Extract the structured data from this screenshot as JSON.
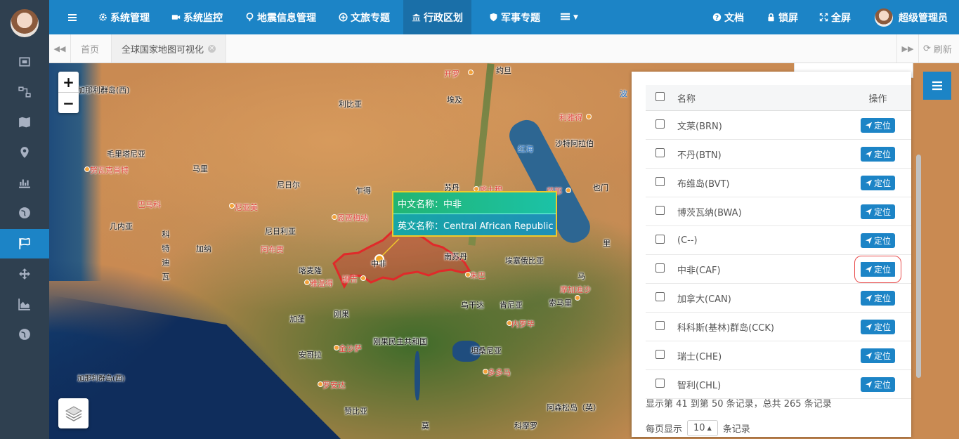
{
  "sidebar": {
    "items": [
      {
        "icon": "frame-icon"
      },
      {
        "icon": "network-icon"
      },
      {
        "icon": "map-icon"
      },
      {
        "icon": "map-marker-icon"
      },
      {
        "icon": "bar-chart-icon"
      },
      {
        "icon": "globe-icon"
      },
      {
        "icon": "flag-icon",
        "active": true
      },
      {
        "icon": "arrows-icon"
      },
      {
        "icon": "area-chart-icon"
      },
      {
        "icon": "globe-icon"
      }
    ]
  },
  "topbar": {
    "menu_icon": "hamburger-icon",
    "nav": [
      {
        "label": "系统管理",
        "icon": "gear-icon"
      },
      {
        "label": "系统监控",
        "icon": "video-icon"
      },
      {
        "label": "地震信息管理",
        "icon": "map-pin-icon"
      },
      {
        "label": "文旅专题",
        "icon": "plus-circle-icon"
      },
      {
        "label": "行政区划",
        "icon": "bank-icon",
        "active": true
      },
      {
        "label": "军事专题",
        "icon": "shield-icon"
      }
    ],
    "right": [
      {
        "label": "文档",
        "icon": "question-icon"
      },
      {
        "label": "锁屏",
        "icon": "lock-icon"
      },
      {
        "label": "全屏",
        "icon": "expand-icon"
      },
      {
        "label": "超级管理员",
        "icon": "avatar"
      }
    ]
  },
  "tabs": {
    "home": "首页",
    "active": "全球国家地图可视化",
    "refresh": "刷新"
  },
  "map": {
    "labels": [
      {
        "text": "利比亚",
        "type": "country"
      },
      {
        "text": "埃及",
        "type": "country"
      },
      {
        "text": "约旦",
        "type": "country"
      },
      {
        "text": "开罗",
        "type": "city"
      },
      {
        "text": "红海",
        "type": "blue"
      },
      {
        "text": "沙特阿拉伯",
        "type": "country"
      },
      {
        "text": "利雅得",
        "type": "city"
      },
      {
        "text": "毛里塔尼亚",
        "type": "country"
      },
      {
        "text": "努瓦克肖特",
        "type": "city"
      },
      {
        "text": "马里",
        "type": "country"
      },
      {
        "text": "尼日尔",
        "type": "country"
      },
      {
        "text": "乍得",
        "type": "country"
      },
      {
        "text": "苏丹",
        "type": "country"
      },
      {
        "text": "喀土穆",
        "type": "city"
      },
      {
        "text": "萨那",
        "type": "city"
      },
      {
        "text": "也门",
        "type": "country"
      },
      {
        "text": "巴马科",
        "type": "city"
      },
      {
        "text": "尼亚美",
        "type": "city"
      },
      {
        "text": "恩贾梅纳",
        "type": "city"
      },
      {
        "text": "几内亚",
        "type": "country"
      },
      {
        "text": "科特迪瓦",
        "type": "country-vertical"
      },
      {
        "text": "加纳",
        "type": "country"
      },
      {
        "text": "尼日利亚",
        "type": "country"
      },
      {
        "text": "阿布贾",
        "type": "city"
      },
      {
        "text": "喀麦隆",
        "type": "country"
      },
      {
        "text": "雅温得",
        "type": "city"
      },
      {
        "text": "班吉",
        "type": "city"
      },
      {
        "text": "中非",
        "type": "country"
      },
      {
        "text": "南苏丹",
        "type": "country"
      },
      {
        "text": "朱巴",
        "type": "city"
      },
      {
        "text": "埃塞俄比亚",
        "type": "country"
      },
      {
        "text": "索马里",
        "type": "country"
      },
      {
        "text": "摩加迪沙",
        "type": "city"
      },
      {
        "text": "加蓬",
        "type": "country"
      },
      {
        "text": "刚果",
        "type": "country"
      },
      {
        "text": "乌干达",
        "type": "country"
      },
      {
        "text": "肯尼亚",
        "type": "country"
      },
      {
        "text": "内罗毕",
        "type": "city"
      },
      {
        "text": "刚果民主共和国",
        "type": "country"
      },
      {
        "text": "金沙萨",
        "type": "city"
      },
      {
        "text": "安哥拉",
        "type": "country"
      },
      {
        "text": "罗安达",
        "type": "city"
      },
      {
        "text": "坦桑尼亚",
        "type": "country"
      },
      {
        "text": "多多马",
        "type": "city"
      },
      {
        "text": "赞比亚",
        "type": "country"
      },
      {
        "text": "莫",
        "type": "country"
      },
      {
        "text": "科摩罗",
        "type": "country"
      },
      {
        "text": "阿森松岛（英）",
        "type": "country"
      },
      {
        "text": "加那利群岛(西)",
        "type": "country"
      },
      {
        "text": "波",
        "type": "blue"
      },
      {
        "text": "马",
        "type": "country"
      },
      {
        "text": "里",
        "type": "country"
      }
    ],
    "zoom_in": "+",
    "zoom_out": "−"
  },
  "popup": {
    "cn_label": "中文名称：中非",
    "en_label": "英文名称：Central African Republic"
  },
  "table": {
    "header_name": "名称",
    "header_action": "操作",
    "rows": [
      {
        "name": "文莱(BRN)",
        "action": "定位"
      },
      {
        "name": "不丹(BTN)",
        "action": "定位"
      },
      {
        "name": "布维岛(BVT)",
        "action": "定位"
      },
      {
        "name": "博茨瓦纳(BWA)",
        "action": "定位"
      },
      {
        "name": "(C--)",
        "action": "定位"
      },
      {
        "name": "中非(CAF)",
        "action": "定位",
        "highlighted": true
      },
      {
        "name": "加拿大(CAN)",
        "action": "定位"
      },
      {
        "name": "科科斯(基林)群岛(CCK)",
        "action": "定位"
      },
      {
        "name": "瑞士(CHE)",
        "action": "定位"
      },
      {
        "name": "智利(CHL)",
        "action": "定位"
      }
    ],
    "summary": "显示第 41 到第 50 条记录，总共 265 条记录",
    "per_page_prefix": "每页显示",
    "per_page_value": "10",
    "per_page_suffix": "条记录"
  },
  "colors": {
    "accent": "#1c84c6",
    "sidebar": "#2f4050",
    "highlight_border": "#e84c4c",
    "country_outline": "#e02a2a"
  }
}
